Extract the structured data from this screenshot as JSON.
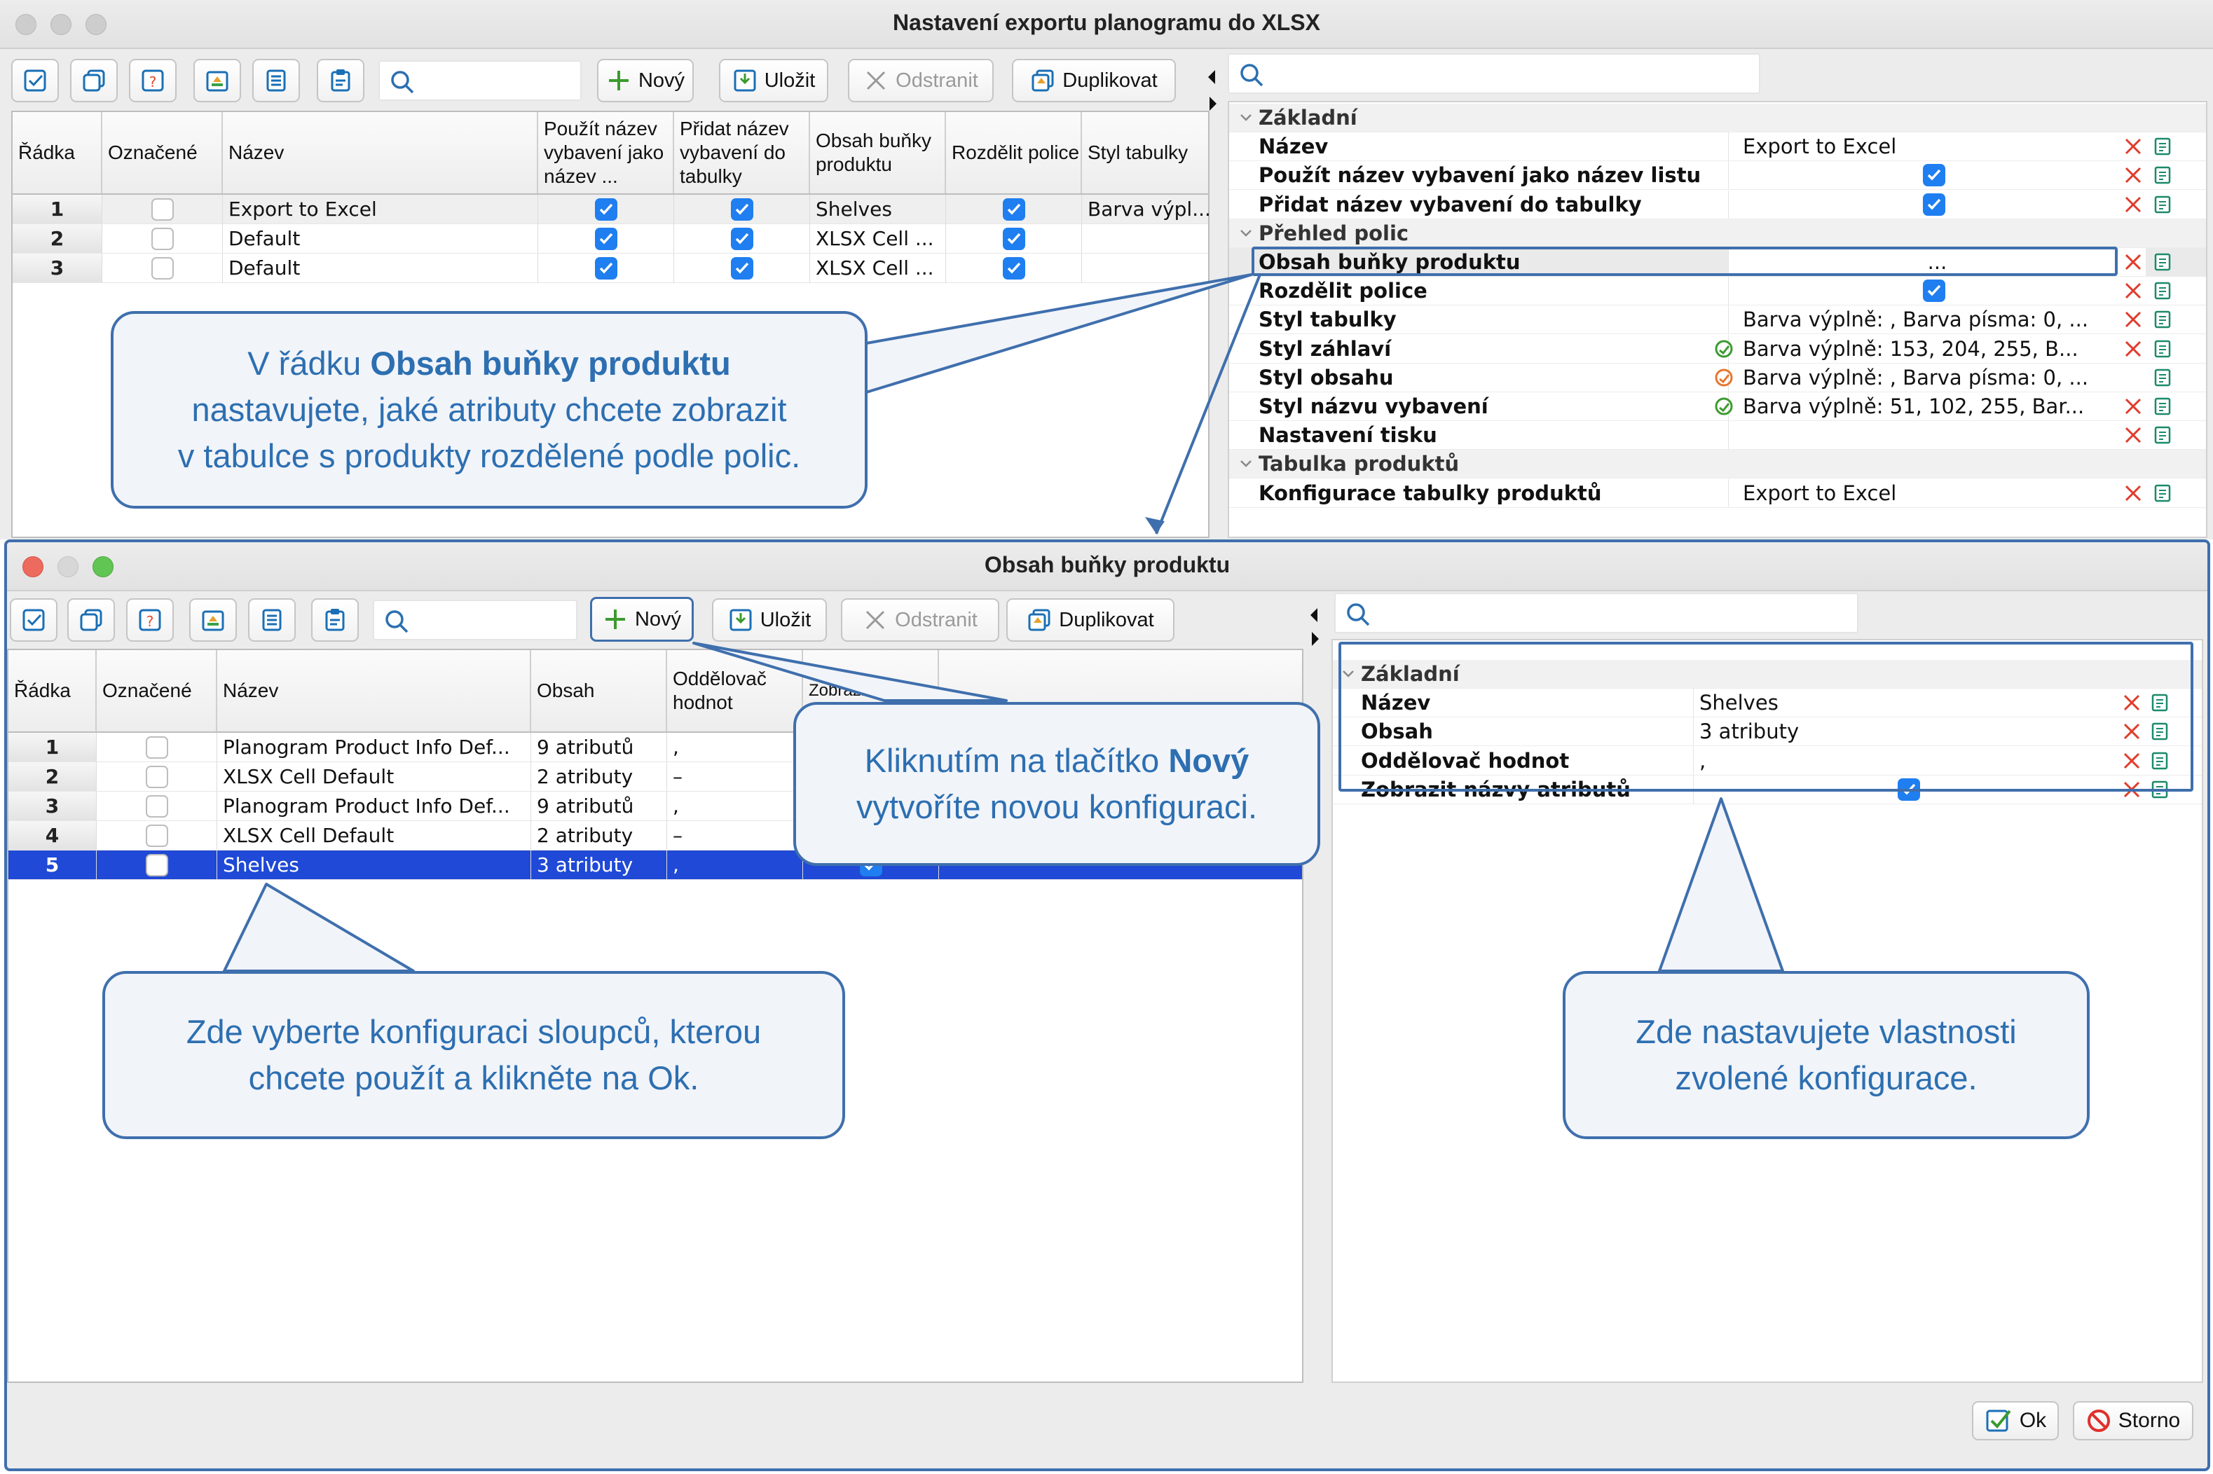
{
  "main_window": {
    "title": "Nastavení exportu planogramu do XLSX",
    "toolbar": {
      "new": "Nový",
      "save": "Uložit",
      "delete": "Odstranit",
      "duplicate": "Duplikovat"
    },
    "grid": {
      "columns": [
        "Řádka",
        "Označené",
        "Název",
        "Použít název vybavení jako název ...",
        "Přidat název vybavení do tabulky",
        "Obsah buňky produktu",
        "Rozdělit police",
        "Styl tabulky"
      ],
      "rows": [
        {
          "num": "1",
          "name": "Export to Excel",
          "content": "Shelves",
          "style": "Barva výpl..."
        },
        {
          "num": "2",
          "name": "Default",
          "content": "XLSX Cell ...",
          "style": ""
        },
        {
          "num": "3",
          "name": "Default",
          "content": "XLSX Cell ...",
          "style": ""
        }
      ]
    },
    "props": {
      "sec_basic": "Základní",
      "name_label": "Název",
      "name_value": "Export to Excel",
      "use_name_label": "Použít název vybavení jako název listu",
      "add_name_label": "Přidat název vybavení do tabulky",
      "sec_shelves": "Přehled polic",
      "cell_content_label": "Obsah buňky produktu",
      "cell_content_value": "...",
      "split_label": "Rozdělit police",
      "table_style_label": "Styl tabulky",
      "table_style_value": "Barva výplně: , Barva písma: 0, ...",
      "header_style_label": "Styl záhlaví",
      "header_style_value": "Barva výplně: 153, 204, 255, B...",
      "content_style_label": "Styl obsahu",
      "content_style_value": "Barva výplně: , Barva písma: 0, ...",
      "equip_style_label": "Styl názvu vybavení",
      "equip_style_value": "Barva výplně: 51, 102, 255, Bar...",
      "print_label": "Nastavení tisku",
      "sec_products": "Tabulka produktů",
      "config_label": "Konfigurace tabulky produktů",
      "config_value": "Export to Excel"
    }
  },
  "dialog": {
    "title": "Obsah buňky produktu",
    "toolbar": {
      "new": "Nový",
      "save": "Uložit",
      "delete": "Odstranit",
      "duplicate": "Duplikovat"
    },
    "grid": {
      "columns": [
        "Řádka",
        "Označené",
        "Název",
        "Obsah",
        "Oddělovač hodnot",
        "Zobrazit názv..."
      ],
      "rows": [
        {
          "num": "1",
          "name": "Planogram Product Info Def...",
          "content": "9 atributů",
          "sep": ","
        },
        {
          "num": "2",
          "name": "XLSX Cell Default",
          "content": "2 atributy",
          "sep": "–"
        },
        {
          "num": "3",
          "name": "Planogram Product Info Def...",
          "content": "9 atributů",
          "sep": ","
        },
        {
          "num": "4",
          "name": "XLSX Cell Default",
          "content": "2 atributy",
          "sep": "–"
        },
        {
          "num": "5",
          "name": "Shelves",
          "content": "3 atributy",
          "sep": ","
        }
      ]
    },
    "props": {
      "sec_basic": "Základní",
      "name_label": "Název",
      "name_value": "Shelves",
      "content_label": "Obsah",
      "content_value": "3 atributy",
      "sep_label": "Oddělovač hodnot",
      "sep_value": ",",
      "show_label": "Zobrazit názvy atributů"
    },
    "ok": "Ok",
    "cancel": "Storno"
  },
  "callouts": {
    "c1_a": "V řádku ",
    "c1_b": "Obsah buňky produktu",
    "c1_l2": "nastavujete, jaké atributy chcete zobrazit",
    "c1_l3": "v tabulce s produkty rozdělené podle polic.",
    "c2_a": "Kliknutím na tlačítko ",
    "c2_b": "Nový",
    "c2_l2": "vytvoříte novou konfiguraci.",
    "c3_l1": "Zde vyberte konfiguraci sloupců, kterou",
    "c3_l2": "chcete použít a klikněte na Ok.",
    "c4_l1": "Zde nastavujete vlastnosti",
    "c4_l2": "zvolené konfigurace."
  },
  "colors": {
    "accent": "#1f7ef0",
    "selection": "#1f49d6",
    "callout_border": "#3f6fad",
    "callout_text": "#2d6fb1"
  }
}
